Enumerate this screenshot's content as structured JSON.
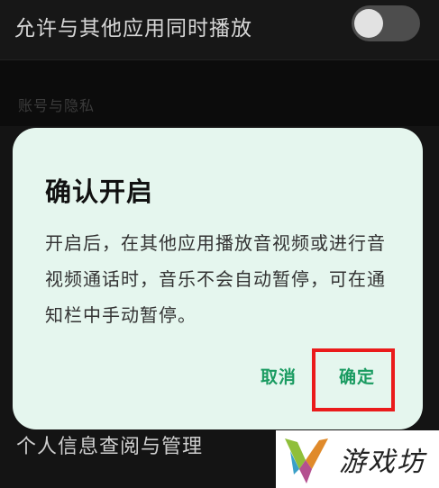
{
  "background": {
    "top_row_label": "允许与其他应用同时播放",
    "top_row_toggle": "off",
    "section_header": "账号与隐私",
    "bottom_row_label": "个人信息查阅与管理"
  },
  "dialog": {
    "title": "确认开启",
    "message": "开启后，在其他应用播放音视频或进行音视频通话时，音乐不会自动暂停，可在通知栏中手动暂停。",
    "cancel_label": "取消",
    "confirm_label": "确定"
  },
  "watermark": {
    "text": "游戏坊"
  },
  "colors": {
    "dialog_bg": "#e5f6ee",
    "accent": "#1a9b61",
    "highlight": "#ea1b1b"
  }
}
